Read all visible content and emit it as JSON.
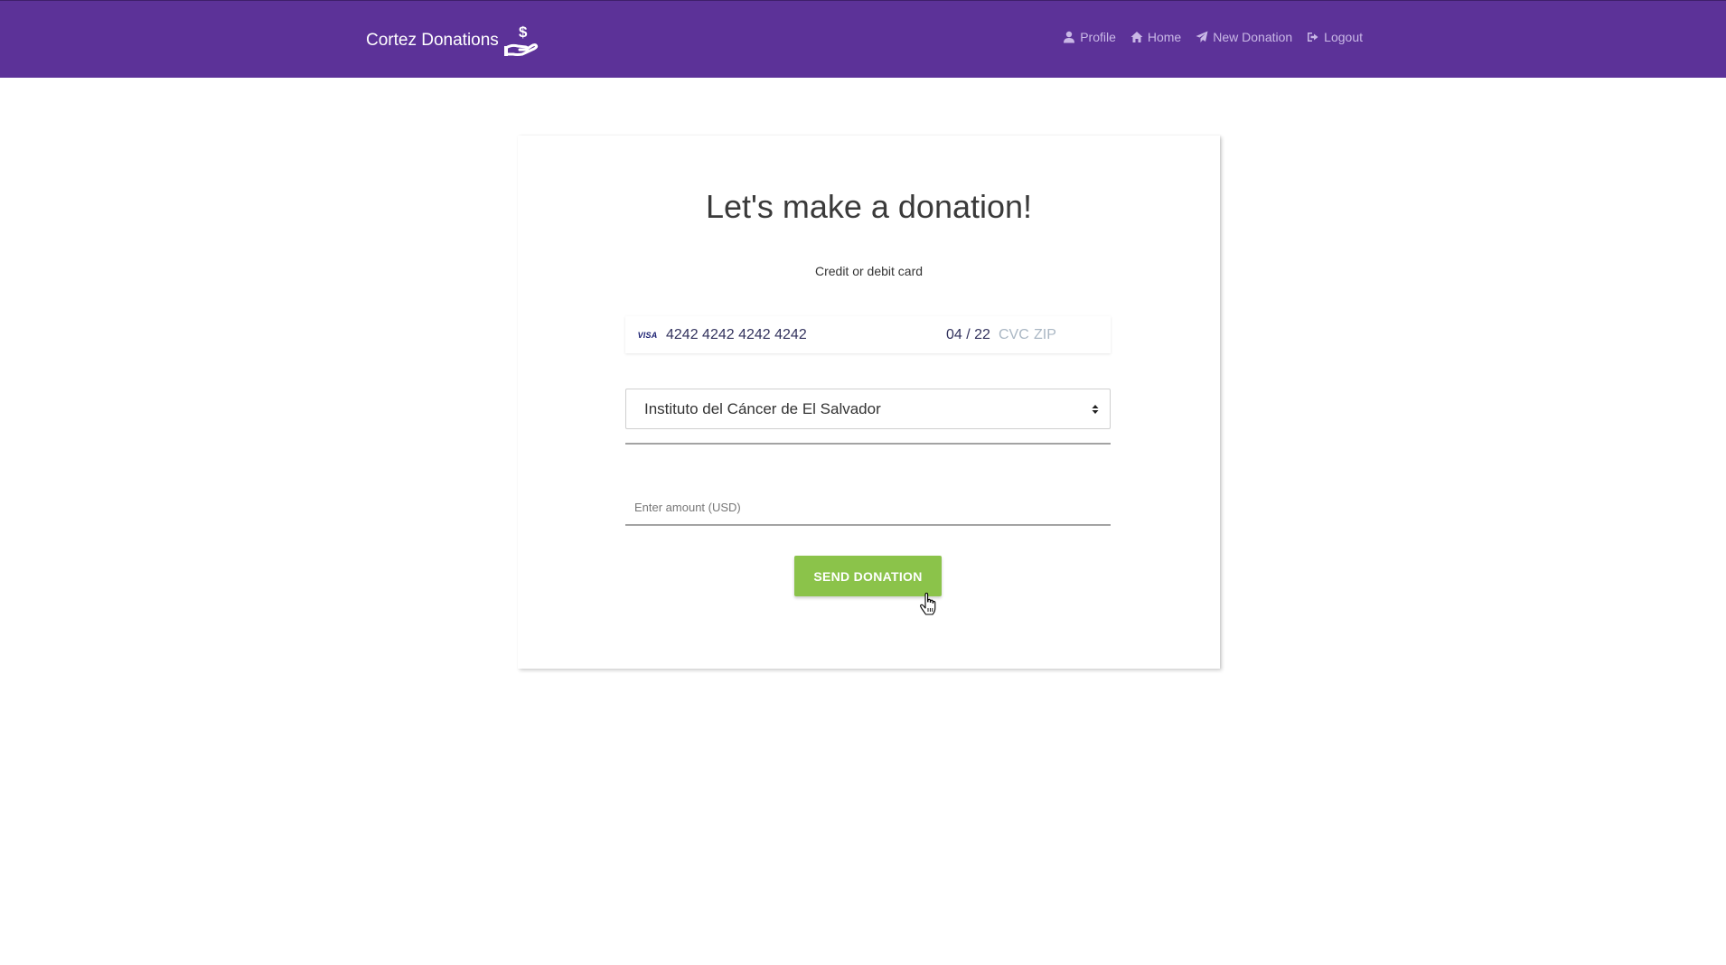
{
  "brand": {
    "name": "Cortez Donations",
    "icon": "hand-dollar-icon"
  },
  "nav": {
    "items": [
      {
        "label": "Profile",
        "icon": "user-icon"
      },
      {
        "label": "Home",
        "icon": "home-icon"
      },
      {
        "label": "New Donation",
        "icon": "paper-plane-icon"
      },
      {
        "label": "Logout",
        "icon": "sign-out-icon"
      }
    ]
  },
  "form": {
    "title": "Let's make a donation!",
    "card_label": "Credit or debit card",
    "card": {
      "brand": "VISA",
      "number": "4242 4242 4242 4242",
      "expiry": "04 / 22",
      "cvc_placeholder": "CVC",
      "zip_placeholder": "ZIP"
    },
    "organization": {
      "selected": "Instituto del Cáncer de El Salvador"
    },
    "amount": {
      "value": "",
      "placeholder": "Enter amount (USD)"
    },
    "submit_label": "SEND DONATION"
  },
  "colors": {
    "navbar": "#5c3298",
    "nav_link": "#c9b8e6",
    "submit": "#8bc34a"
  }
}
